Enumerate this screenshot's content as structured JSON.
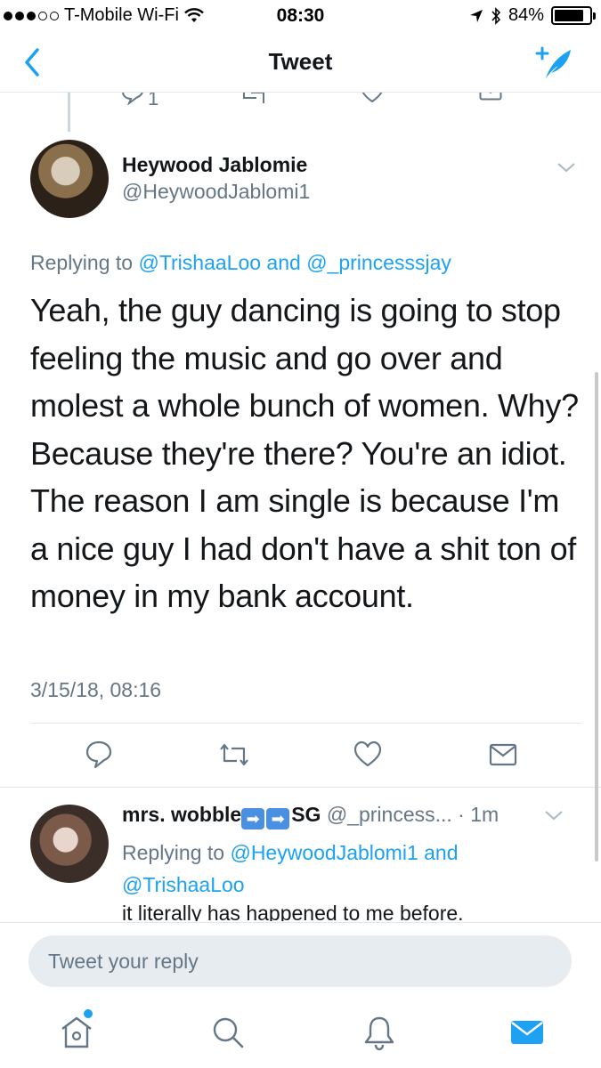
{
  "status_bar": {
    "carrier": "T-Mobile Wi-Fi",
    "time": "08:30",
    "battery_percent": "84%",
    "battery_level": 0.84
  },
  "nav": {
    "title": "Tweet",
    "back_icon": "chevron-left-icon",
    "compose_icon": "compose-tweet-icon"
  },
  "prev_tweet": {
    "reply_count": "1"
  },
  "tweet": {
    "author_name": "Heywood Jablomie",
    "author_handle": "@HeywoodJablomi1",
    "replying_prefix": "Replying to ",
    "replying_user1": "@TrishaaLoo",
    "replying_and": " and ",
    "replying_user2": "@_princesssjay",
    "text": "Yeah, the guy dancing is going to stop feeling the music and go over and molest a whole bunch of women. Why? Because they're there? You're an idiot. The reason I am single is because I'm a nice guy I had don't have a shit ton of money in my bank account.",
    "timestamp": "3/15/18, 08:16"
  },
  "actions": {
    "icons": [
      "reply-icon",
      "retweet-icon",
      "like-icon",
      "direct-message-icon"
    ]
  },
  "reply": {
    "name_prefix": "mrs. wobble",
    "name_suffix": "SG",
    "handle": "@_princess...",
    "separator": " · ",
    "age": "1m",
    "replying_prefix": "Replying to ",
    "replying_user1": "@HeywoodJablomi1",
    "replying_and": " and",
    "replying_user2": "@TrishaaLoo",
    "text": "it literally has happened to me before."
  },
  "composer": {
    "placeholder": "Tweet your reply"
  },
  "tabbar": {
    "tabs": [
      "home-icon",
      "search-icon",
      "notifications-icon",
      "messages-icon"
    ],
    "active": "messages-icon"
  },
  "colors": {
    "accent": "#1da1f2",
    "secondary_text": "#657786",
    "divider": "#e1e8ed"
  }
}
